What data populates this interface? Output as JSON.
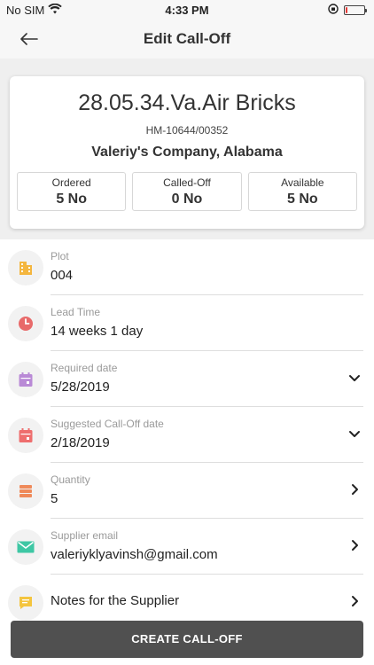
{
  "status_bar": {
    "carrier": "No SIM",
    "time": "4:33 PM",
    "battery_level": 0.1
  },
  "nav": {
    "title": "Edit Call-Off",
    "back_icon": "arrow-left-icon"
  },
  "card": {
    "title": "28.05.34.Va.Air Bricks",
    "code": "HM-10644/00352",
    "company": "Valeriy's Company, Alabama",
    "stats": [
      {
        "label": "Ordered",
        "value": "5 No"
      },
      {
        "label": "Called-Off",
        "value": "0 No"
      },
      {
        "label": "Available",
        "value": "5 No"
      }
    ]
  },
  "fields": {
    "plot": {
      "label": "Plot",
      "value": "004",
      "icon": "building-icon",
      "color": "#f4b63f"
    },
    "lead_time": {
      "label": "Lead Time",
      "value": "14 weeks 1 day",
      "icon": "clock-icon",
      "color": "#e86a6a"
    },
    "required_date": {
      "label": "Required date",
      "value": "5/28/2019",
      "icon": "calendar-icon",
      "color": "#b98ad6"
    },
    "suggested_date": {
      "label": "Suggested Call-Off date",
      "value": "2/18/2019",
      "icon": "calendar-icon",
      "color": "#ee6e6e"
    },
    "quantity": {
      "label": "Quantity",
      "value": "5",
      "icon": "stack-icon",
      "color": "#ef8a5a"
    },
    "supplier_email": {
      "label": "Supplier email",
      "value": "valeriyklyavinsh@gmail.com",
      "icon": "mail-icon",
      "color": "#3ec7a4"
    },
    "notes": {
      "label": "Notes for the Supplier",
      "icon": "note-icon",
      "color": "#f4c53f"
    }
  },
  "actions": {
    "create_label": "CREATE CALL-OFF"
  }
}
